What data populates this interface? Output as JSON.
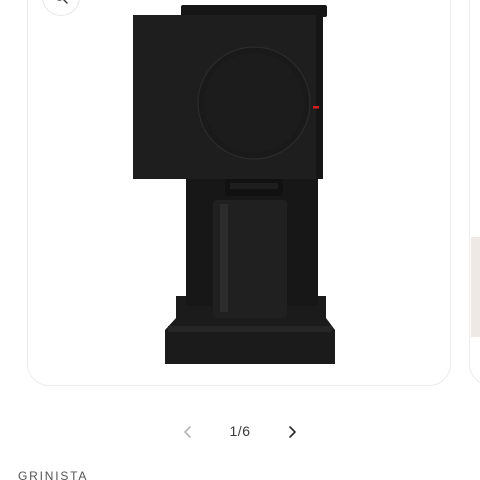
{
  "gallery": {
    "pager_label": "1/6",
    "zoom_icon": "magnifier-icon",
    "prev_icon": "chevron-left-icon",
    "next_icon": "chevron-right-icon"
  },
  "product": {
    "vendor": "GRINISTA"
  },
  "colors": {
    "product_body": "#1e1e1e",
    "accent_dot": "#d02020",
    "card_border": "#ececec"
  }
}
